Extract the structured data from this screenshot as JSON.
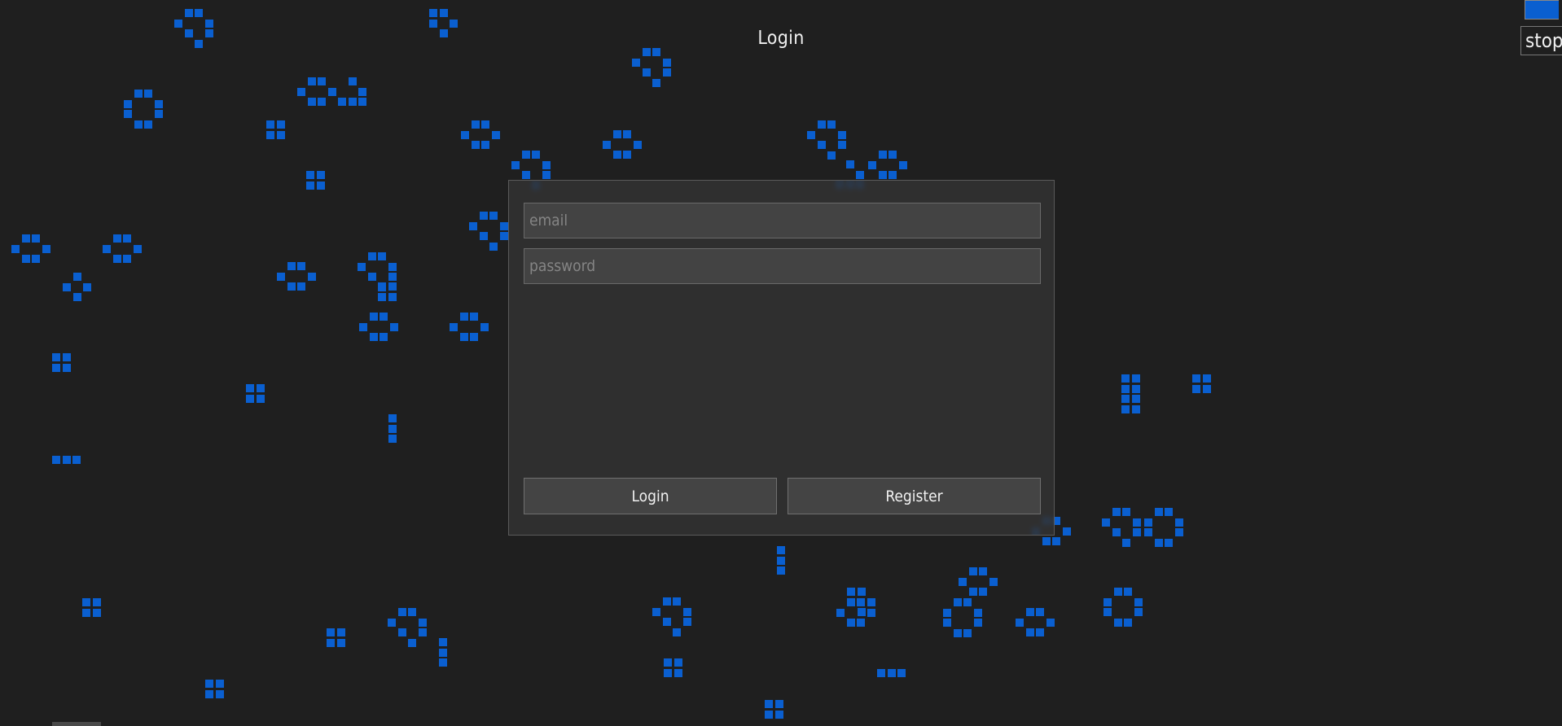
{
  "page": {
    "title": "Login"
  },
  "controls": {
    "stop_label": "stop",
    "accent_color": "#0a5fd0"
  },
  "login_form": {
    "email_placeholder": "email",
    "password_placeholder": "password",
    "login_label": "Login",
    "register_label": "Register"
  },
  "colors": {
    "background": "#1f1f1f",
    "cell": "#0a5fd0"
  }
}
